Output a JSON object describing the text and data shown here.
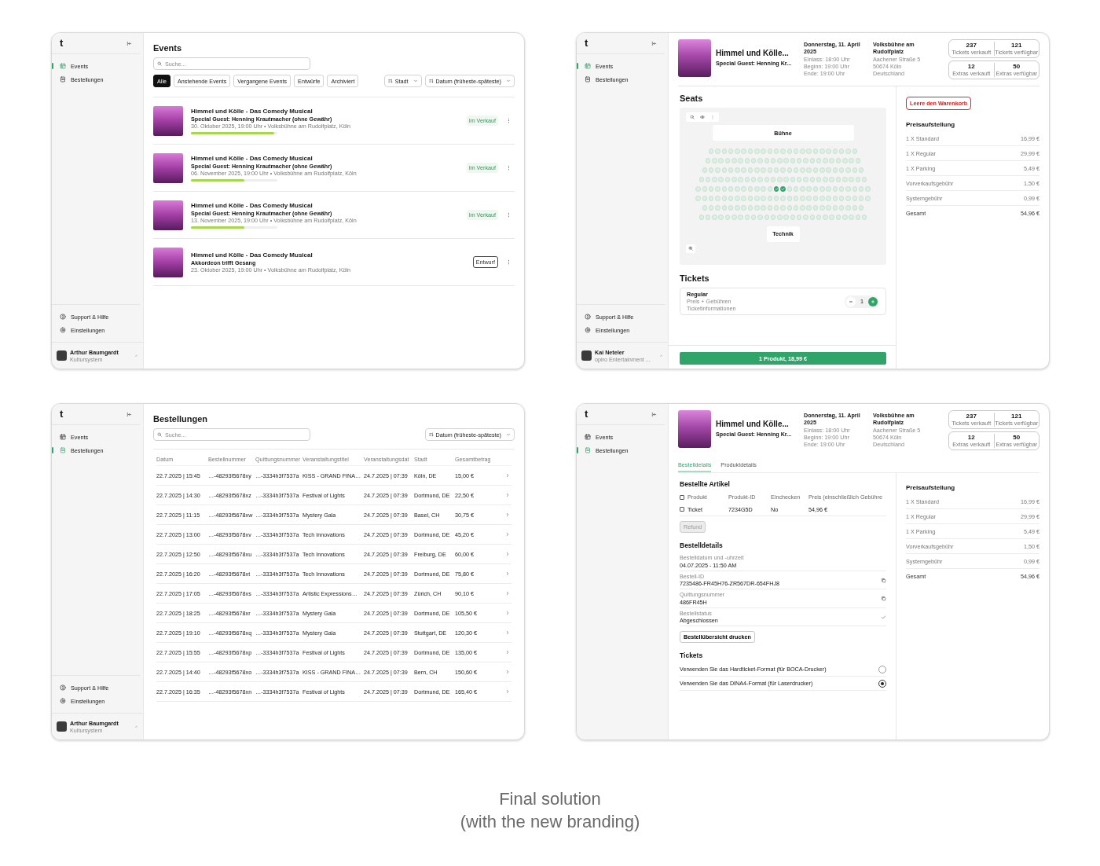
{
  "screens": [
    {
      "kind": "events",
      "sidebar": {
        "logo": "t",
        "nav": [
          {
            "label": "Events",
            "selected": true
          },
          {
            "label": "Bestellungen",
            "selected": false
          }
        ],
        "footer_nav": [
          "Support & Hilfe",
          "Einstellungen"
        ],
        "user": {
          "name": "Arthur Baumgardt",
          "org": "Kultursystem"
        }
      },
      "title": "Events",
      "search": {
        "placeholder": "Suche..."
      },
      "filters": [
        {
          "label": "Alle",
          "selected": true
        },
        {
          "label": "Anstehende Events",
          "selected": false
        },
        {
          "label": "Vergangene Events",
          "selected": false
        },
        {
          "label": "Entwürfe",
          "selected": false
        },
        {
          "label": "Archiviert",
          "selected": false
        }
      ],
      "sorts": [
        "Stadt",
        "Datum (früheste-späteste)"
      ],
      "events": [
        {
          "title": "Himmel und Kölle - Das Comedy Musical",
          "subtitle": "Special Guest: Henning Krautmacher (ohne Gewähr)",
          "meta": "30. Oktober 2025, 19:00 Uhr • Volksbühne am Rudolfplatz, Köln",
          "level": 0.96,
          "status": "Im Verkauf",
          "kind": "on_sale"
        },
        {
          "title": "Himmel und Kölle - Das Comedy Musical",
          "subtitle": "Special Guest: Henning Krautmacher (ohne Gewähr)",
          "meta": "06. November 2025, 19:00 Uhr • Volksbühne am Rudolfplatz, Köln",
          "level": 0.62,
          "status": "Im Verkauf",
          "kind": "on_sale"
        },
        {
          "title": "Himmel und Kölle - Das Comedy Musical",
          "subtitle": "Special Guest: Henning Krautmacher (ohne Gewähr)",
          "meta": "13. November 2025, 19:00 Uhr • Volksbühne am Rudolfplatz, Köln",
          "level": 0.62,
          "status": "Im Verkauf",
          "kind": "on_sale"
        },
        {
          "title": "Himmel und Kölle - Das Comedy Musical",
          "subtitle": "Akkordeon trifft Gesang",
          "meta": "23. Oktober 2025, 19:00 Uhr • Volksbühne am Rudolfplatz, Köln",
          "status": "Entwurf",
          "kind": "draft"
        }
      ]
    },
    {
      "kind": "event_detail",
      "sidebar": {
        "logo": "t",
        "nav": [
          {
            "label": "Events",
            "selected": true
          },
          {
            "label": "Bestellungen",
            "selected": false
          }
        ],
        "footer_nav": [
          "Support & Hilfe",
          "Einstellungen"
        ],
        "user": {
          "name": "Kai Neteler",
          "org": "opiro Entertainment ..."
        }
      },
      "event": {
        "title": "Himmel und Kölle...",
        "subtitle": "Special Guest: Henning Kr...",
        "date": "Donnerstag, 11. April 2025",
        "times": [
          "Einlass: 18:00 Uhr",
          "Beginn: 19:00 Uhr",
          "Ende: 19:00 Uhr"
        ],
        "venue": "Volksbühne am Rudolfplatz",
        "address": [
          "Aachener Straße 5",
          "50674 Köln",
          "Deutschland"
        ],
        "stats": [
          [
            {
              "value": "237",
              "label": "Tickets verkauft"
            },
            {
              "value": "121",
              "label": "Tickets verfügbar"
            }
          ],
          [
            {
              "value": "12",
              "label": "Extras verkauft"
            },
            {
              "value": "50",
              "label": "Extras verfügbar"
            }
          ]
        ]
      },
      "seats": {
        "title": "Seats",
        "stage": "Bühne",
        "tech": "Technik",
        "rows": [
          {
            "seats": [
              {
                "selected": false
              },
              {
                "selected": false
              },
              {
                "selected": false
              },
              {
                "selected": false
              },
              {
                "selected": false
              },
              {
                "selected": false
              },
              {
                "selected": false
              },
              {
                "selected": false
              },
              {
                "selected": false
              },
              {
                "selected": false
              },
              {
                "selected": false
              },
              {
                "selected": false
              },
              {
                "selected": false
              },
              {
                "selected": false
              },
              {
                "selected": false
              },
              {
                "selected": false
              },
              {
                "selected": false
              },
              {
                "selected": false
              },
              {
                "selected": false
              },
              {
                "selected": false
              },
              {
                "selected": false
              },
              {
                "selected": false
              },
              {
                "selected": false
              }
            ]
          },
          {
            "seats": [
              {
                "selected": false
              },
              {
                "selected": false
              },
              {
                "selected": false
              },
              {
                "selected": false
              },
              {
                "selected": false
              },
              {
                "selected": false
              },
              {
                "selected": false
              },
              {
                "selected": false
              },
              {
                "selected": false
              },
              {
                "selected": false
              },
              {
                "selected": false
              },
              {
                "selected": false
              },
              {
                "selected": false
              },
              {
                "selected": false
              },
              {
                "selected": false
              },
              {
                "selected": false
              },
              {
                "selected": false
              },
              {
                "selected": false
              },
              {
                "selected": false
              },
              {
                "selected": false
              },
              {
                "selected": false
              },
              {
                "selected": false
              },
              {
                "selected": false
              },
              {
                "selected": false
              }
            ]
          },
          {
            "seats": [
              {
                "selected": false
              },
              {
                "selected": false
              },
              {
                "selected": false
              },
              {
                "selected": false
              },
              {
                "selected": false
              },
              {
                "selected": false
              },
              {
                "selected": false
              },
              {
                "selected": false
              },
              {
                "selected": false
              },
              {
                "selected": false
              },
              {
                "selected": false
              },
              {
                "selected": false
              },
              {
                "selected": false
              },
              {
                "selected": false
              },
              {
                "selected": false
              },
              {
                "selected": false
              },
              {
                "selected": false
              },
              {
                "selected": false
              },
              {
                "selected": false
              },
              {
                "selected": false
              },
              {
                "selected": false
              },
              {
                "selected": false
              },
              {
                "selected": false
              },
              {
                "selected": false
              },
              {
                "selected": false
              }
            ]
          },
          {
            "seats": [
              {
                "selected": false
              },
              {
                "selected": false
              },
              {
                "selected": false
              },
              {
                "selected": false
              },
              {
                "selected": false
              },
              {
                "selected": false
              },
              {
                "selected": false
              },
              {
                "selected": false
              },
              {
                "selected": false
              },
              {
                "selected": false
              },
              {
                "selected": false
              },
              {
                "selected": false
              },
              {
                "selected": false
              },
              {
                "selected": false
              },
              {
                "selected": false
              },
              {
                "selected": false
              },
              {
                "selected": false
              },
              {
                "selected": false
              },
              {
                "selected": false
              },
              {
                "selected": false
              },
              {
                "selected": false
              },
              {
                "selected": false
              },
              {
                "selected": false
              },
              {
                "selected": false
              },
              {
                "selected": false
              },
              {
                "selected": false
              }
            ]
          },
          {
            "seats": [
              {
                "selected": false
              },
              {
                "selected": false
              },
              {
                "selected": false
              },
              {
                "selected": false
              },
              {
                "selected": false
              },
              {
                "selected": false
              },
              {
                "selected": false
              },
              {
                "selected": false
              },
              {
                "selected": false
              },
              {
                "selected": false
              },
              {
                "selected": false
              },
              {
                "selected": false
              },
              {
                "selected": true
              },
              {
                "selected": true
              },
              {
                "selected": false
              },
              {
                "selected": false
              },
              {
                "selected": false
              },
              {
                "selected": false
              },
              {
                "selected": false
              },
              {
                "selected": false
              },
              {
                "selected": false
              },
              {
                "selected": false
              },
              {
                "selected": false
              },
              {
                "selected": false
              },
              {
                "selected": false
              },
              {
                "selected": false
              },
              {
                "selected": false
              }
            ]
          },
          {
            "seats": [
              {
                "selected": false
              },
              {
                "selected": false
              },
              {
                "selected": false
              },
              {
                "selected": false
              },
              {
                "selected": false
              },
              {
                "selected": false
              },
              {
                "selected": false
              },
              {
                "selected": false
              },
              {
                "selected": false
              },
              {
                "selected": false
              },
              {
                "selected": false
              },
              {
                "selected": false
              },
              {
                "selected": false
              },
              {
                "selected": false
              },
              {
                "selected": false
              },
              {
                "selected": false
              },
              {
                "selected": false
              },
              {
                "selected": false
              },
              {
                "selected": false
              },
              {
                "selected": false
              },
              {
                "selected": false
              },
              {
                "selected": false
              },
              {
                "selected": false
              },
              {
                "selected": false
              },
              {
                "selected": false
              },
              {
                "selected": false
              },
              {
                "selected": false
              }
            ]
          },
          {
            "seats": [
              {
                "selected": false
              },
              {
                "selected": false
              },
              {
                "selected": false
              },
              {
                "selected": false
              },
              {
                "selected": false
              },
              {
                "selected": false
              },
              {
                "selected": false
              },
              {
                "selected": false
              },
              {
                "selected": false
              },
              {
                "selected": false
              },
              {
                "selected": false
              },
              {
                "selected": false
              },
              {
                "selected": false
              },
              {
                "selected": false
              },
              {
                "selected": false
              },
              {
                "selected": false
              },
              {
                "selected": false
              },
              {
                "selected": false
              },
              {
                "selected": false
              },
              {
                "selected": false
              },
              {
                "selected": false
              },
              {
                "selected": false
              },
              {
                "selected": false
              },
              {
                "selected": false
              },
              {
                "selected": false
              }
            ]
          },
          {
            "seats": [
              {
                "selected": false
              },
              {
                "selected": false
              },
              {
                "selected": false
              },
              {
                "selected": false
              },
              {
                "selected": false
              },
              {
                "selected": false
              },
              {
                "selected": false
              },
              {
                "selected": false
              },
              {
                "selected": false
              },
              {
                "selected": false
              },
              {
                "selected": false
              },
              {
                "selected": false
              },
              {
                "selected": false
              },
              {
                "selected": false
              },
              {
                "selected": false
              },
              {
                "selected": false
              },
              {
                "selected": false
              },
              {
                "selected": false
              },
              {
                "selected": false
              },
              {
                "selected": false
              },
              {
                "selected": false
              },
              {
                "selected": false
              },
              {
                "selected": false
              },
              {
                "selected": false
              },
              {
                "selected": false
              },
              {
                "selected": false
              }
            ]
          }
        ]
      },
      "tickets": {
        "title": "Tickets",
        "items": [
          {
            "name": "Regular",
            "lines": [
              "Preis + Gebühren",
              "Ticketinformationen"
            ],
            "quantity": "1"
          }
        ]
      },
      "checkout": "1 Produkt, 18,99 €",
      "clear_cart": "Leere den Warenkorb",
      "prices": {
        "title": "Preisaufstellung",
        "rows": [
          {
            "label": "1 X Standard",
            "value": "16,99 €"
          },
          {
            "label": "1 X Regular",
            "value": "29,99 €"
          },
          {
            "label": "1 X Parking",
            "value": "5,49 €"
          },
          {
            "label": "Vorverkaufsgebühr",
            "value": "1,50 €"
          },
          {
            "label": "Systemgebühr",
            "value": "0,99 €"
          }
        ],
        "total": {
          "label": "Gesamt",
          "value": "54,96 €"
        }
      }
    },
    {
      "kind": "orders",
      "sidebar": {
        "logo": "t",
        "nav": [
          {
            "label": "Events",
            "selected": false
          },
          {
            "label": "Bestellungen",
            "selected": true
          }
        ],
        "footer_nav": [
          "Support & Hilfe",
          "Einstellungen"
        ],
        "user": {
          "name": "Arthur Baumgardt",
          "org": "Kultursystem"
        }
      },
      "title": "Bestellungen",
      "search": {
        "placeholder": "Suche..."
      },
      "sort": "Datum (früheste-späteste)",
      "table": {
        "columns": [
          "Datum",
          "Bestellnummer",
          "Quittungsnummer",
          "Veranstaltungstitel",
          "Veranstaltungsdat",
          "Stadt",
          "Gesamtbetrag"
        ],
        "rows": [
          [
            "22.7.2025 | 15:45",
            "…-48293f5678xy",
            "…-3334h3f7537a",
            "KISS - GRAND FINA…",
            "24.7.2025 | 07:39",
            "Köln, DE",
            "15,00 €"
          ],
          [
            "22.7.2025 | 14:30",
            "…-48293f5678xz",
            "…-3334h3f7537a",
            "Festival of Lights",
            "24.7.2025 | 07:39",
            "Dortmund, DE",
            "22,50 €"
          ],
          [
            "22.7.2025 | 11:15",
            "…-48293f5678xw",
            "…-3334h3f7537a",
            "Mystery Gala",
            "24.7.2025 | 07:39",
            "Basel, CH",
            "30,75 €"
          ],
          [
            "22.7.2025 | 13:00",
            "…-48293f5678xv",
            "…-3334h3f7537a",
            "Tech Innovations",
            "24.7.2025 | 07:39",
            "Dortmund, DE",
            "45,20 €"
          ],
          [
            "22.7.2025 | 12:50",
            "…-48293f5678xu",
            "…-3334h3f7537a",
            "Tech Innovations",
            "24.7.2025 | 07:39",
            "Freiburg, DE",
            "60,00 €"
          ],
          [
            "22.7.2025 | 16:20",
            "…-48293f5678xt",
            "…-3334h3f7537a",
            "Tech Innovations",
            "24.7.2025 | 07:39",
            "Dortmund, DE",
            "75,80 €"
          ],
          [
            "22.7.2025 | 17:05",
            "…-48293f5678xs",
            "…-3334h3f7537a",
            "Artistic Expressions…",
            "24.7.2025 | 07:39",
            "Zürich, CH",
            "90,10 €"
          ],
          [
            "22.7.2025 | 18:25",
            "…-48293f5678xr",
            "…-3334h3f7537a",
            "Mystery Gala",
            "24.7.2025 | 07:39",
            "Dortmund, DE",
            "105,50 €"
          ],
          [
            "22.7.2025 | 19:10",
            "…-48293f5678xq",
            "…-3334h3f7537a",
            "Mystery Gala",
            "24.7.2025 | 07:39",
            "Stuttgart, DE",
            "120,30 €"
          ],
          [
            "22.7.2025 | 15:55",
            "…-48293f5678xp",
            "…-3334h3f7537a",
            "Festival of Lights",
            "24.7.2025 | 07:39",
            "Dortmund, DE",
            "135,00 €"
          ],
          [
            "22.7.2025 | 14:40",
            "…-48293f5678xo",
            "…-3334h3f7537a",
            "KISS - GRAND FINA…",
            "24.7.2025 | 07:39",
            "Bern, CH",
            "150,60 €"
          ],
          [
            "22.7.2025 | 16:35",
            "…-48293f5678xn",
            "…-3334h3f7537a",
            "Festival of Lights",
            "24.7.2025 | 07:39",
            "Dortmund, DE",
            "165,40 €"
          ]
        ]
      }
    },
    {
      "kind": "order_detail",
      "sidebar": {
        "logo": "t",
        "nav": [
          {
            "label": "Events",
            "selected": false
          },
          {
            "label": "Bestellungen",
            "selected": true
          }
        ]
      },
      "event": {
        "title": "Himmel und Kölle...",
        "subtitle": "Special Guest: Henning Kr...",
        "date": "Donnerstag, 11. April 2025",
        "times": [
          "Einlass: 18:00 Uhr",
          "Beginn: 19:00 Uhr",
          "Ende: 19:00 Uhr"
        ],
        "venue": "Volksbühne am Rudolfplatz",
        "address": [
          "Aachener Straße 5",
          "50674 Köln",
          "Deutschland"
        ],
        "stats": [
          [
            {
              "value": "237",
              "label": "Tickets verkauft"
            },
            {
              "value": "121",
              "label": "Tickets verfügbar"
            }
          ],
          [
            {
              "value": "12",
              "label": "Extras verkauft"
            },
            {
              "value": "50",
              "label": "Extras verfügbar"
            }
          ]
        ]
      },
      "tabs": [
        {
          "label": "Bestelldetails",
          "selected": true
        },
        {
          "label": "Produktdetails",
          "selected": false
        }
      ],
      "articles": {
        "title": "Bestellte Artikel",
        "columns": [
          "Produkt",
          "Produkt-ID",
          "Einchecken",
          "Preis (einschließlich Gebühre"
        ],
        "all_checked": false,
        "rows": [
          {
            "checked": false,
            "cells": [
              "Ticket",
              "7234G5D",
              "No",
              "54,96 €"
            ]
          }
        ]
      },
      "refund": {
        "label": "Refund",
        "disabled": true
      },
      "details": {
        "title": "Bestelldetails",
        "fields": [
          {
            "label": "Bestelldatum und -uhrzeit",
            "value": "04.07.2025 - 11:50 AM",
            "kind": "plain"
          },
          {
            "label": "Bestell-ID",
            "value": "7235486-FR45H76-ZR567DR-654FHJ8",
            "kind": "copy"
          },
          {
            "label": "Quittungsnummer",
            "value": "486FR45H",
            "kind": "copy"
          },
          {
            "label": "Bestellstatus",
            "value": "Abgeschlossen",
            "kind": "check"
          }
        ]
      },
      "print": "Bestellübersicht drucken",
      "ticket_formats": {
        "title": "Tickets",
        "options": [
          {
            "label": "Verwenden Sie das Hardticket-Format (für BOCA-Drucker)",
            "selected": false
          },
          {
            "label": "Verwenden Sie das DINA4-Format (für Laserdrucker)",
            "selected": true
          }
        ]
      },
      "prices": {
        "title": "Preisaufstellung",
        "rows": [
          {
            "label": "1 X Standard",
            "value": "16,99 €"
          },
          {
            "label": "1 X Regular",
            "value": "29,99 €"
          },
          {
            "label": "1 X Parking",
            "value": "5,49 €"
          },
          {
            "label": "Vorverkaufsgebühr",
            "value": "1,50 €"
          },
          {
            "label": "Systemgebühr",
            "value": "0,99 €"
          }
        ],
        "total": {
          "label": "Gesamt",
          "value": "54,96 €"
        }
      }
    }
  ],
  "caption": {
    "title": "Final solution",
    "subtitle": "(with the new branding)"
  }
}
